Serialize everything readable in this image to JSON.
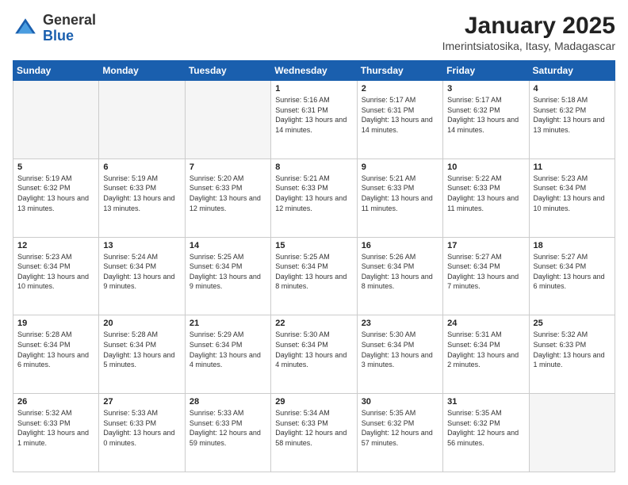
{
  "logo": {
    "general": "General",
    "blue": "Blue"
  },
  "header": {
    "title": "January 2025",
    "subtitle": "Imerintsiatosika, Itasy, Madagascar"
  },
  "weekdays": [
    "Sunday",
    "Monday",
    "Tuesday",
    "Wednesday",
    "Thursday",
    "Friday",
    "Saturday"
  ],
  "weeks": [
    [
      {
        "day": "",
        "empty": true
      },
      {
        "day": "",
        "empty": true
      },
      {
        "day": "",
        "empty": true
      },
      {
        "day": "1",
        "sunrise": "5:16 AM",
        "sunset": "6:31 PM",
        "daylight": "13 hours and 14 minutes."
      },
      {
        "day": "2",
        "sunrise": "5:17 AM",
        "sunset": "6:31 PM",
        "daylight": "13 hours and 14 minutes."
      },
      {
        "day": "3",
        "sunrise": "5:17 AM",
        "sunset": "6:32 PM",
        "daylight": "13 hours and 14 minutes."
      },
      {
        "day": "4",
        "sunrise": "5:18 AM",
        "sunset": "6:32 PM",
        "daylight": "13 hours and 13 minutes."
      }
    ],
    [
      {
        "day": "5",
        "sunrise": "5:19 AM",
        "sunset": "6:32 PM",
        "daylight": "13 hours and 13 minutes."
      },
      {
        "day": "6",
        "sunrise": "5:19 AM",
        "sunset": "6:33 PM",
        "daylight": "13 hours and 13 minutes."
      },
      {
        "day": "7",
        "sunrise": "5:20 AM",
        "sunset": "6:33 PM",
        "daylight": "13 hours and 12 minutes."
      },
      {
        "day": "8",
        "sunrise": "5:21 AM",
        "sunset": "6:33 PM",
        "daylight": "13 hours and 12 minutes."
      },
      {
        "day": "9",
        "sunrise": "5:21 AM",
        "sunset": "6:33 PM",
        "daylight": "13 hours and 11 minutes."
      },
      {
        "day": "10",
        "sunrise": "5:22 AM",
        "sunset": "6:33 PM",
        "daylight": "13 hours and 11 minutes."
      },
      {
        "day": "11",
        "sunrise": "5:23 AM",
        "sunset": "6:34 PM",
        "daylight": "13 hours and 10 minutes."
      }
    ],
    [
      {
        "day": "12",
        "sunrise": "5:23 AM",
        "sunset": "6:34 PM",
        "daylight": "13 hours and 10 minutes."
      },
      {
        "day": "13",
        "sunrise": "5:24 AM",
        "sunset": "6:34 PM",
        "daylight": "13 hours and 9 minutes."
      },
      {
        "day": "14",
        "sunrise": "5:25 AM",
        "sunset": "6:34 PM",
        "daylight": "13 hours and 9 minutes."
      },
      {
        "day": "15",
        "sunrise": "5:25 AM",
        "sunset": "6:34 PM",
        "daylight": "13 hours and 8 minutes."
      },
      {
        "day": "16",
        "sunrise": "5:26 AM",
        "sunset": "6:34 PM",
        "daylight": "13 hours and 8 minutes."
      },
      {
        "day": "17",
        "sunrise": "5:27 AM",
        "sunset": "6:34 PM",
        "daylight": "13 hours and 7 minutes."
      },
      {
        "day": "18",
        "sunrise": "5:27 AM",
        "sunset": "6:34 PM",
        "daylight": "13 hours and 6 minutes."
      }
    ],
    [
      {
        "day": "19",
        "sunrise": "5:28 AM",
        "sunset": "6:34 PM",
        "daylight": "13 hours and 6 minutes."
      },
      {
        "day": "20",
        "sunrise": "5:28 AM",
        "sunset": "6:34 PM",
        "daylight": "13 hours and 5 minutes."
      },
      {
        "day": "21",
        "sunrise": "5:29 AM",
        "sunset": "6:34 PM",
        "daylight": "13 hours and 4 minutes."
      },
      {
        "day": "22",
        "sunrise": "5:30 AM",
        "sunset": "6:34 PM",
        "daylight": "13 hours and 4 minutes."
      },
      {
        "day": "23",
        "sunrise": "5:30 AM",
        "sunset": "6:34 PM",
        "daylight": "13 hours and 3 minutes."
      },
      {
        "day": "24",
        "sunrise": "5:31 AM",
        "sunset": "6:34 PM",
        "daylight": "13 hours and 2 minutes."
      },
      {
        "day": "25",
        "sunrise": "5:32 AM",
        "sunset": "6:33 PM",
        "daylight": "13 hours and 1 minute."
      }
    ],
    [
      {
        "day": "26",
        "sunrise": "5:32 AM",
        "sunset": "6:33 PM",
        "daylight": "13 hours and 1 minute."
      },
      {
        "day": "27",
        "sunrise": "5:33 AM",
        "sunset": "6:33 PM",
        "daylight": "13 hours and 0 minutes."
      },
      {
        "day": "28",
        "sunrise": "5:33 AM",
        "sunset": "6:33 PM",
        "daylight": "12 hours and 59 minutes."
      },
      {
        "day": "29",
        "sunrise": "5:34 AM",
        "sunset": "6:33 PM",
        "daylight": "12 hours and 58 minutes."
      },
      {
        "day": "30",
        "sunrise": "5:35 AM",
        "sunset": "6:32 PM",
        "daylight": "12 hours and 57 minutes."
      },
      {
        "day": "31",
        "sunrise": "5:35 AM",
        "sunset": "6:32 PM",
        "daylight": "12 hours and 56 minutes."
      },
      {
        "day": "",
        "empty": true
      }
    ]
  ]
}
